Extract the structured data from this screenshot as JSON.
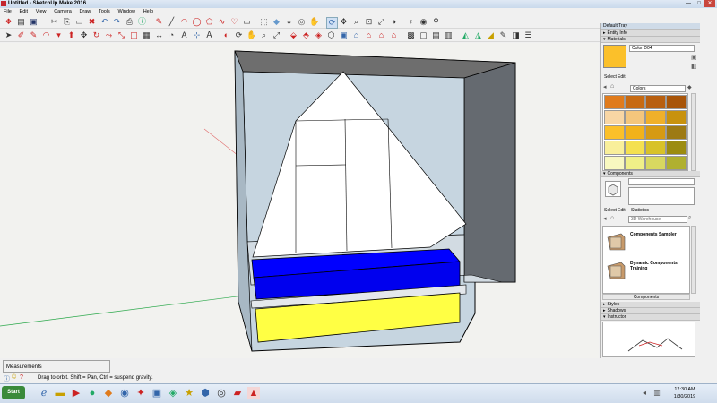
{
  "window": {
    "title": "Untitled - SketchUp Make 2016",
    "minimize": "—",
    "maximize": "□",
    "close": "✕"
  },
  "menu": [
    "File",
    "Edit",
    "View",
    "Camera",
    "Draw",
    "Tools",
    "Window",
    "Help"
  ],
  "tray": {
    "title": "Default Tray",
    "entity_info": "Entity Info",
    "materials": "Materials",
    "color_name": "Color D04",
    "mat_tabs": [
      "Select",
      "Edit"
    ],
    "mat_library": "Colors",
    "components": "Components",
    "comp_tabs": [
      "Select",
      "Edit",
      "Statistics"
    ],
    "comp_search": "3D Warehouse",
    "comp_items": [
      "Components Sampler",
      "Dynamic Components Training"
    ],
    "comp_footer": "Components",
    "styles": "Styles",
    "shadows": "Shadows",
    "instructor": "Instructor"
  },
  "swatches": [
    "#e07b1c",
    "#c76a12",
    "#b85f10",
    "#a85509",
    "#f8d6a4",
    "#f4c67c",
    "#f0b02a",
    "#c8920e",
    "#fbc02a",
    "#f2b21a",
    "#d69a12",
    "#9d7a14",
    "#f9ef9a",
    "#f4e050",
    "#d8c228",
    "#9c8c10",
    "#f8f8c0",
    "#f0f088",
    "#d8d860",
    "#b0b030"
  ],
  "status": {
    "measurements": "Measurements",
    "hint": "Drag to orbit. Shift = Pan, Ctrl = suspend gravity."
  },
  "clock": {
    "time": "12:30 AM",
    "date": "1/30/2019"
  },
  "colors": {
    "wall_fill": "#c6d5e0",
    "blue": "#0000ff",
    "yellow": "#ffff44",
    "sky": "#f2f2ef"
  }
}
